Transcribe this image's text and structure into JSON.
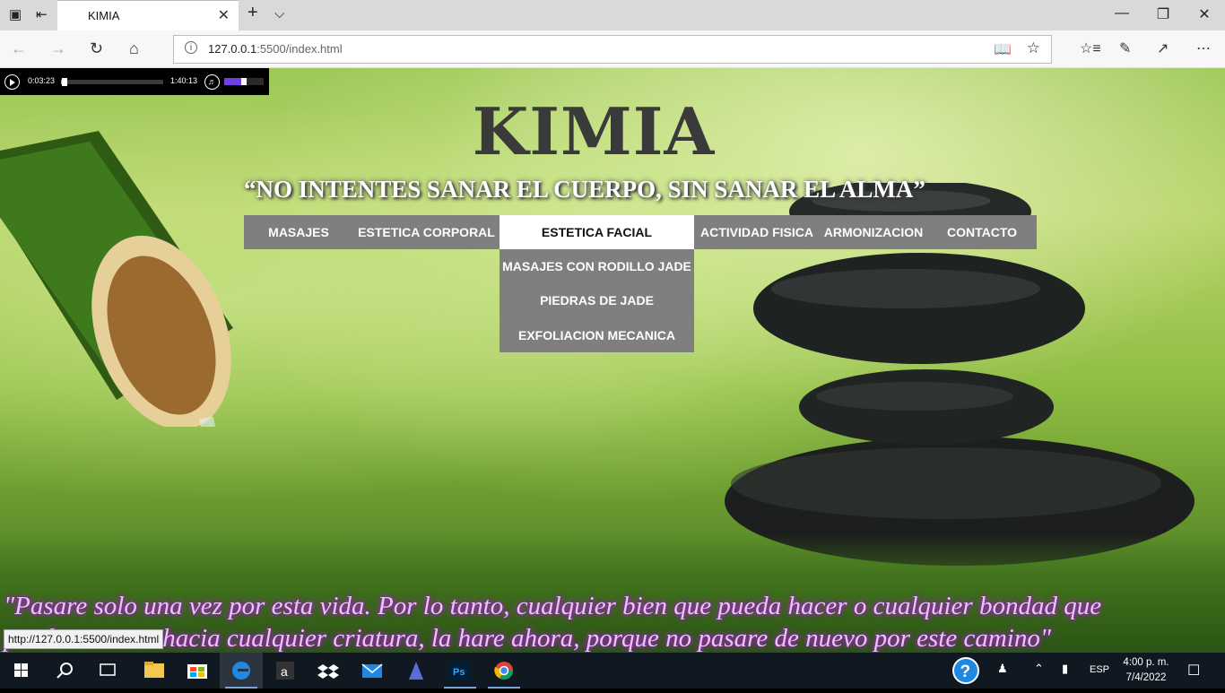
{
  "browser": {
    "tab_title": "KIMIA",
    "tab_close": "✕",
    "new_tab": "+",
    "tab_list": "⌵",
    "address_host": "127.0.0.1",
    "address_rest": ":5500/index.html",
    "status_url": "http://127.0.0.1:5500/index.html"
  },
  "player": {
    "current_time": "0:03:23",
    "total_time": "1:40:13",
    "progress": 0.034,
    "volume": 0.5
  },
  "site": {
    "title": "KIMIA",
    "subtitle": "“NO INTENTES SANAR EL CUERPO, SIN SANAR EL ALMA”",
    "menu": [
      {
        "label": "MASAJES"
      },
      {
        "label": "ESTETICA CORPORAL"
      },
      {
        "label": "ESTETICA FACIAL"
      },
      {
        "label": "ACTIVIDAD FISICA"
      },
      {
        "label": "ARMONIZACION"
      },
      {
        "label": "CONTACTO"
      }
    ],
    "submenu": [
      {
        "label": "MASAJES CON RODILLO JADE"
      },
      {
        "label": "PIEDRAS DE JADE"
      },
      {
        "label": "EXFOLIACION MECANICA"
      }
    ],
    "quote_line1": "\"Pasare solo una vez por esta vida. Por lo tanto, cualquier bien que pueda hacer o cualquier bondad que",
    "quote_line2": "pueda mostrar hacia cualquier criatura, la hare ahora, porque no pasare de nuevo por este camino\""
  },
  "taskbar": {
    "language": "ESP",
    "time": "4:00 p. m.",
    "date": "7/4/2022"
  },
  "colors": {
    "menu_bg": "#7f7f7f",
    "quote_glow": "#b02ad0",
    "taskbar_bg": "#101822"
  }
}
